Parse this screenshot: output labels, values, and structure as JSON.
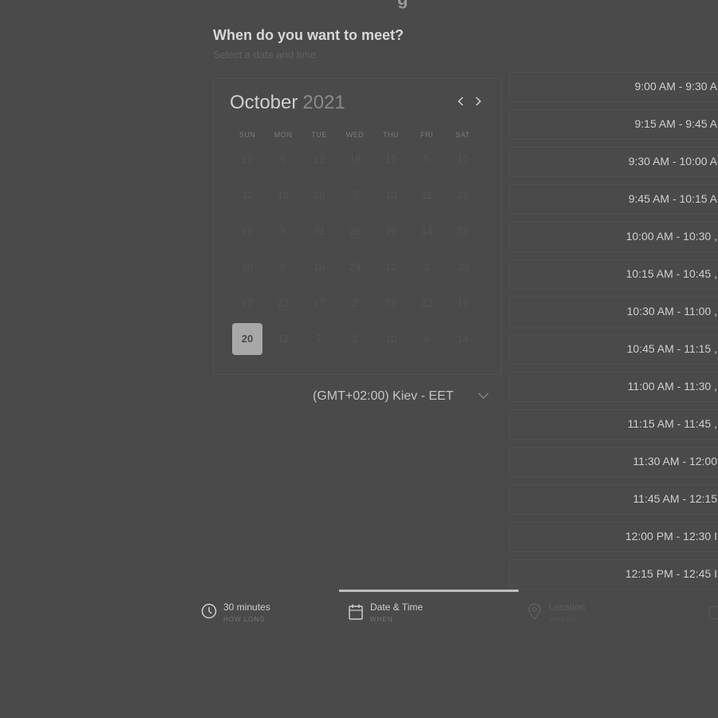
{
  "page_title_partial": "g",
  "heading": "When do you want to meet?",
  "subheading": "Select a date and time",
  "calendar": {
    "month": "October",
    "year": "2021",
    "weekdays": [
      "SUN",
      "MON",
      "TUE",
      "WED",
      "THU",
      "FRI",
      "SAT"
    ],
    "weeks": [
      [
        "10",
        "6",
        "12",
        "18",
        "15",
        "5",
        "10"
      ],
      [
        "12",
        "18",
        "26",
        "7",
        "10",
        "11",
        "29"
      ],
      [
        "18",
        "8",
        "31",
        "26",
        "26",
        "14",
        "28"
      ],
      [
        "30",
        "8",
        "16",
        "29",
        "12",
        "3",
        "20"
      ],
      [
        "12",
        "23",
        "17",
        "2",
        "28",
        "22",
        "19"
      ],
      [
        "20",
        "12",
        "7",
        "2",
        "10",
        "8",
        "14"
      ]
    ],
    "selected_day": "20"
  },
  "timezone": "(GMT+02:00) Kiev - EET",
  "time_slots": [
    "9:00 AM - 9:30 A",
    "9:15 AM - 9:45 A",
    "9:30 AM - 10:00 A",
    "9:45 AM - 10:15 A",
    "10:00 AM - 10:30 ,",
    "10:15 AM - 10:45 ,",
    "10:30 AM - 11:00 ,",
    "10:45 AM - 11:15 ,",
    "11:00 AM - 11:30 ,",
    "11:15 AM - 11:45 ,",
    "11:30 AM - 12:00",
    "11:45 AM - 12:15",
    "12:00 PM - 12:30 I",
    "12:15 PM - 12:45 I"
  ],
  "tabs": [
    {
      "title": "30 minutes",
      "subtitle": "HOW LONG",
      "icon": "clock-icon"
    },
    {
      "title": "Date & Time",
      "subtitle": "WHEN",
      "icon": "calendar-icon"
    },
    {
      "title": "Location",
      "subtitle": "WHERE",
      "icon": "location-pin-icon"
    }
  ],
  "colors": {
    "background": "#4a4a4a",
    "selected_day_bg": "#a8a8a8",
    "active_tab_indicator": "#bdbdbd"
  }
}
